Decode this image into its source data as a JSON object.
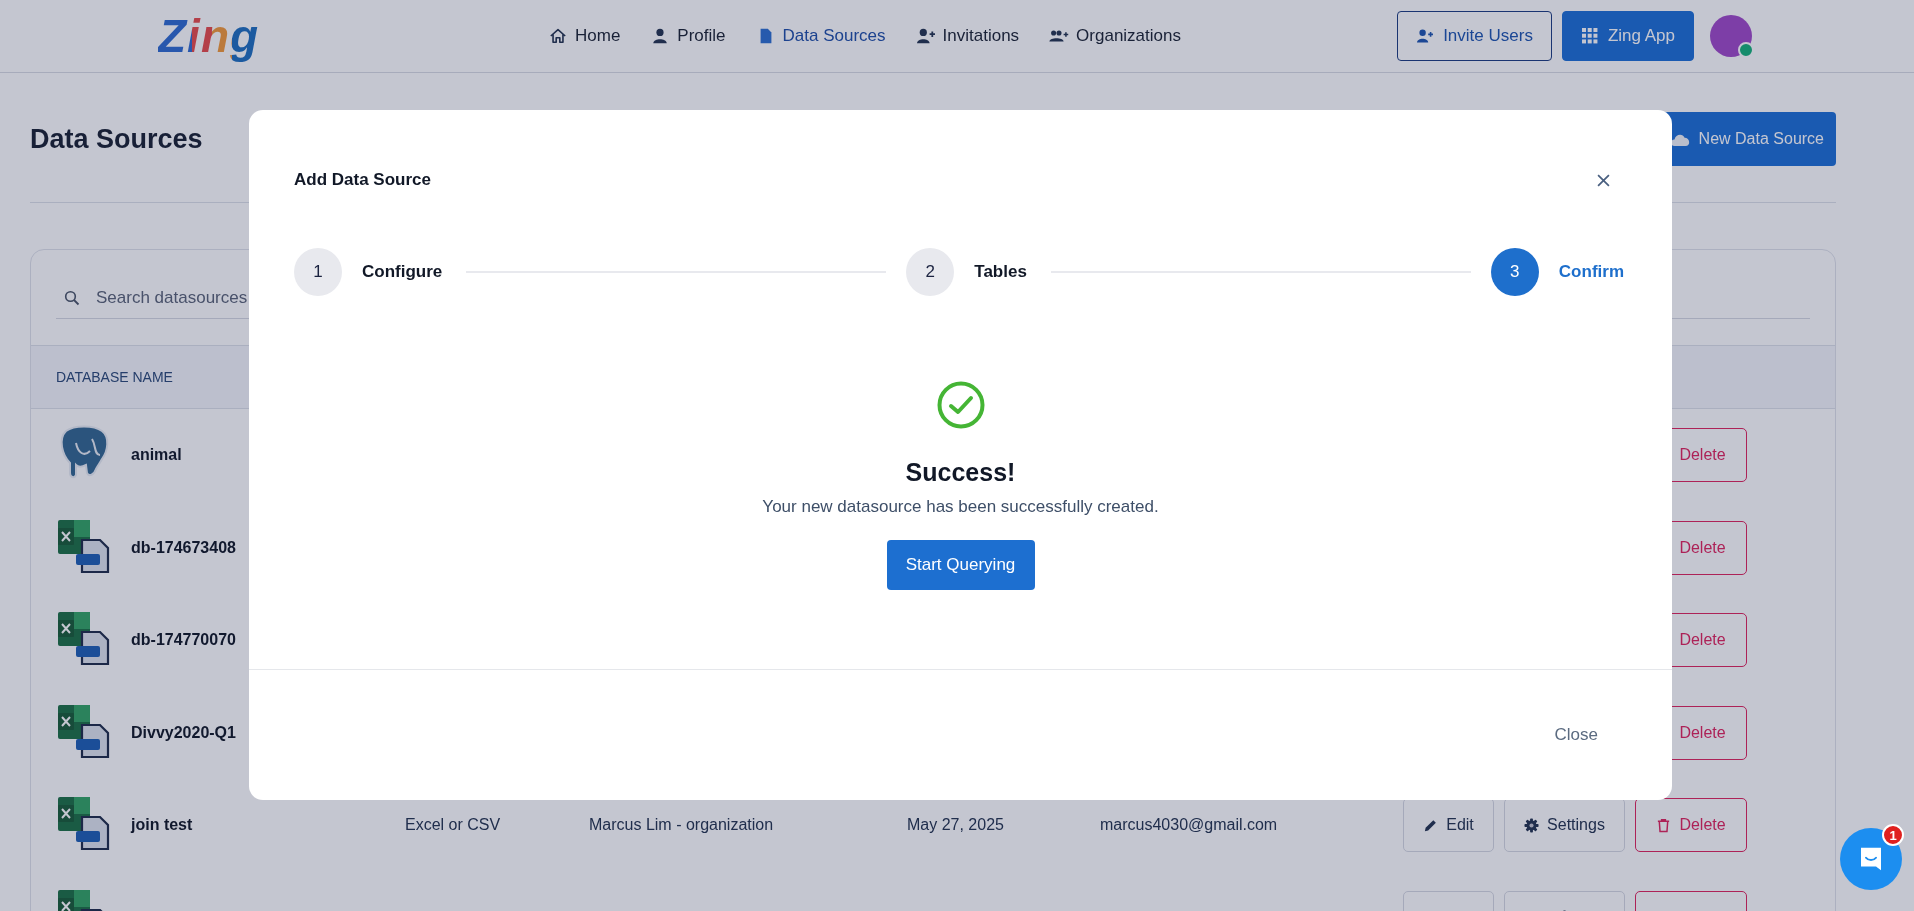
{
  "header": {
    "logo": "Zing",
    "nav": [
      {
        "label": "Home",
        "selected": false
      },
      {
        "label": "Profile",
        "selected": false
      },
      {
        "label": "Data Sources",
        "selected": true
      },
      {
        "label": "Invitations",
        "selected": false
      },
      {
        "label": "Organizations",
        "selected": false
      }
    ],
    "buttons": [
      {
        "label": "Invite Users",
        "kind": "outline"
      },
      {
        "label": "Zing App",
        "kind": "primary"
      }
    ],
    "avatar": {
      "online": true
    }
  },
  "page": {
    "title": "Data Sources",
    "new_button": "New Data Source"
  },
  "search": {
    "placeholder": "Search datasources"
  },
  "table": {
    "columns": [
      "DATABASE NAME"
    ],
    "rows": [
      {
        "kind": "postgres",
        "name": "animal",
        "actions": [
          {
            "kind": "delete",
            "label": "Delete"
          }
        ]
      },
      {
        "kind": "excel",
        "name": "db-174673408",
        "actions": [
          {
            "kind": "delete",
            "label": "Delete"
          }
        ]
      },
      {
        "kind": "excel",
        "name": "db-174770070",
        "actions": [
          {
            "kind": "delete",
            "label": "Delete"
          }
        ]
      },
      {
        "kind": "excel",
        "name": "Divvy2020-Q1",
        "actions": [
          {
            "kind": "delete",
            "label": "Delete"
          }
        ]
      },
      {
        "kind": "excel",
        "name": "join test",
        "type": "Excel or CSV",
        "owner": "Marcus Lim - organization",
        "date": "May 27, 2025",
        "email": "marcus4030@gmail.com",
        "actions": [
          {
            "kind": "edit",
            "label": "Edit"
          },
          {
            "kind": "settings",
            "label": "Settings"
          },
          {
            "kind": "delete",
            "label": "Delete"
          }
        ]
      },
      {
        "kind": "excel",
        "actions": [
          {
            "kind": "edit"
          },
          {
            "kind": "settings"
          },
          {
            "kind": "delete"
          }
        ]
      }
    ]
  },
  "modal": {
    "title": "Add Data Source",
    "steps": [
      {
        "number": "1",
        "label": "Configure",
        "selected": false
      },
      {
        "number": "2",
        "label": "Tables",
        "selected": false
      },
      {
        "number": "3",
        "label": "Confirm",
        "selected": true
      }
    ],
    "success": {
      "heading": "Success!",
      "message": "Your new datasource has been successfully created.",
      "button": "Start Querying"
    },
    "footer_button": "Close"
  },
  "chat": {
    "badge": "1"
  }
}
